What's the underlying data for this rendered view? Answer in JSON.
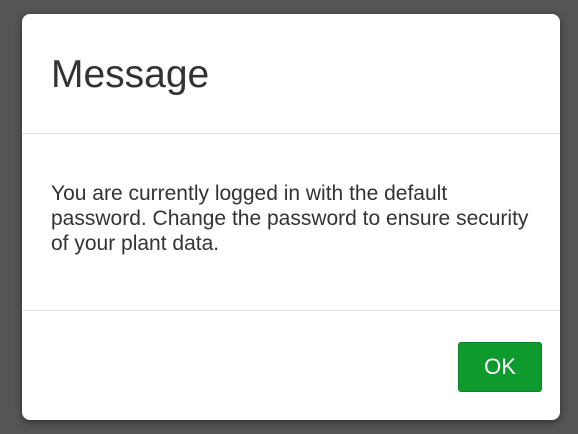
{
  "dialog": {
    "title": "Message",
    "message": "You are currently logged in with the default password. Change the password to ensure security of your plant data.",
    "ok_label": "OK"
  },
  "colors": {
    "backdrop": "#555555",
    "dialog_background": "#ffffff",
    "ok_button": "#0f9a2e",
    "text": "#333333"
  }
}
